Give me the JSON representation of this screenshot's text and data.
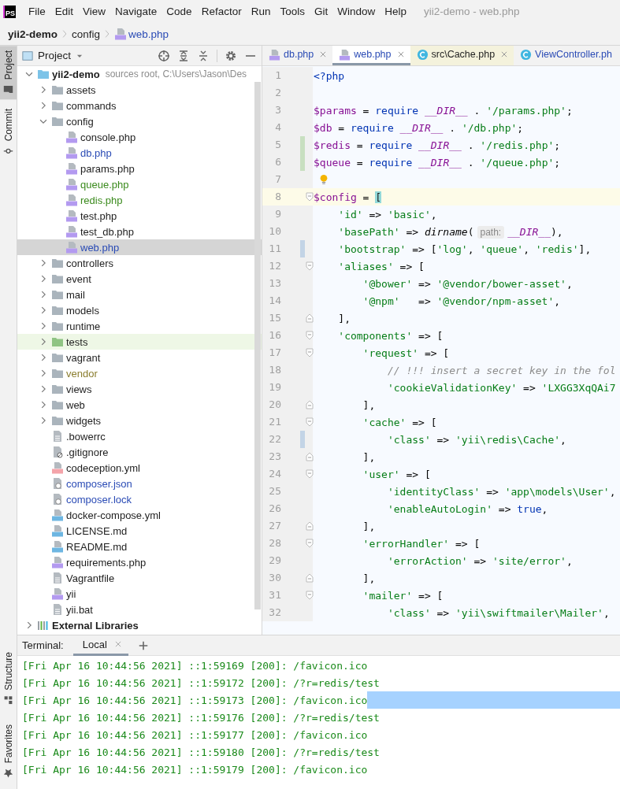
{
  "menu": {
    "logo": "PS",
    "items": [
      "File",
      "Edit",
      "View",
      "Navigate",
      "Code",
      "Refactor",
      "Run",
      "Tools",
      "Git",
      "Window",
      "Help"
    ],
    "title": "yii2-demo - web.php"
  },
  "breadcrumb": [
    {
      "label": "yii2-demo",
      "kind": "project"
    },
    {
      "label": "config",
      "kind": "folder"
    },
    {
      "label": "web.php",
      "kind": "php"
    }
  ],
  "tool_strip": {
    "top": [
      {
        "label": "Project",
        "kind": "project",
        "selected": true
      },
      {
        "label": "Commit",
        "kind": "commit",
        "selected": false
      }
    ],
    "bottom": [
      {
        "label": "Structure",
        "kind": "structure",
        "selected": false
      },
      {
        "label": "Favorites",
        "kind": "favorites",
        "selected": false
      }
    ]
  },
  "project_panel": {
    "title": "Project",
    "items": [
      {
        "name": "yii2-demo",
        "kind": "module",
        "hint": "sources root, C:\\Users\\Jason\\Des",
        "expanded": true,
        "selected": false,
        "children": [
          {
            "name": "assets",
            "kind": "folder",
            "expanded": false,
            "selected": false
          },
          {
            "name": "commands",
            "kind": "folder",
            "expanded": false,
            "selected": false
          },
          {
            "name": "config",
            "kind": "folder",
            "expanded": true,
            "selected": false,
            "children": [
              {
                "name": "console.php",
                "kind": "php",
                "selected": false
              },
              {
                "name": "db.php",
                "kind": "php",
                "color": "#2a4bb5",
                "selected": false
              },
              {
                "name": "params.php",
                "kind": "php",
                "selected": false
              },
              {
                "name": "queue.php",
                "kind": "php",
                "color": "#3a8a1c",
                "selected": false
              },
              {
                "name": "redis.php",
                "kind": "php",
                "color": "#3a8a1c",
                "selected": false
              },
              {
                "name": "test.php",
                "kind": "php",
                "selected": false
              },
              {
                "name": "test_db.php",
                "kind": "php",
                "selected": false
              },
              {
                "name": "web.php",
                "kind": "php",
                "color": "#2a4bb5",
                "selected": true
              }
            ]
          },
          {
            "name": "controllers",
            "kind": "folder",
            "expanded": false,
            "selected": false
          },
          {
            "name": "event",
            "kind": "folder",
            "expanded": false,
            "selected": false
          },
          {
            "name": "mail",
            "kind": "folder",
            "expanded": false,
            "selected": false
          },
          {
            "name": "models",
            "kind": "folder",
            "expanded": false,
            "selected": false
          },
          {
            "name": "runtime",
            "kind": "folder",
            "expanded": false,
            "selected": false
          },
          {
            "name": "tests",
            "kind": "test-folder",
            "expanded": false,
            "selected": false
          },
          {
            "name": "vagrant",
            "kind": "folder",
            "expanded": false,
            "selected": false
          },
          {
            "name": "vendor",
            "kind": "folder",
            "color": "#8a7d2e",
            "expanded": false,
            "selected": false
          },
          {
            "name": "views",
            "kind": "folder",
            "expanded": false,
            "selected": false
          },
          {
            "name": "web",
            "kind": "folder",
            "expanded": false,
            "selected": false
          },
          {
            "name": "widgets",
            "kind": "folder",
            "expanded": false,
            "selected": false
          },
          {
            "name": ".bowerrc",
            "kind": "text",
            "selected": false
          },
          {
            "name": ".gitignore",
            "kind": "ignore",
            "selected": false
          },
          {
            "name": "codeception.yml",
            "kind": "yml",
            "selected": false
          },
          {
            "name": "composer.json",
            "kind": "json",
            "color": "#2a4bb5",
            "selected": false
          },
          {
            "name": "composer.lock",
            "kind": "json",
            "color": "#2a4bb5",
            "selected": false
          },
          {
            "name": "docker-compose.yml",
            "kind": "dc",
            "selected": false
          },
          {
            "name": "LICENSE.md",
            "kind": "md",
            "selected": false
          },
          {
            "name": "README.md",
            "kind": "md",
            "selected": false
          },
          {
            "name": "requirements.php",
            "kind": "php",
            "selected": false
          },
          {
            "name": "Vagrantfile",
            "kind": "text",
            "selected": false
          },
          {
            "name": "yii",
            "kind": "php",
            "selected": false
          },
          {
            "name": "yii.bat",
            "kind": "text",
            "selected": false
          }
        ]
      },
      {
        "name": "External Libraries",
        "kind": "libraries",
        "expanded": false,
        "selected": false
      }
    ]
  },
  "editor": {
    "tabs": [
      {
        "label": "db.php",
        "kind": "php",
        "selected": false,
        "closable": true,
        "non_project": false
      },
      {
        "label": "web.php",
        "kind": "php",
        "selected": true,
        "closable": true,
        "non_project": false
      },
      {
        "label": "src\\Cache.php",
        "kind": "class",
        "selected": false,
        "closable": true,
        "non_project": true
      },
      {
        "label": "ViewController.ph",
        "kind": "class",
        "selected": false,
        "closable": false,
        "non_project": false
      }
    ],
    "lines": [
      {
        "number": "1",
        "current": false,
        "bulb": false,
        "fold_start": false,
        "fold_end": false,
        "tokens": [
          {
            "kind": "keyword",
            "text": "<?php"
          }
        ]
      },
      {
        "number": "2",
        "current": false,
        "bulb": false,
        "fold_start": false,
        "fold_end": false
      },
      {
        "number": "3",
        "current": false,
        "bulb": false,
        "fold_start": false,
        "fold_end": false,
        "tokens": [
          {
            "kind": "variable",
            "text": "$params"
          },
          {
            "kind": "plain",
            "text": " = "
          },
          {
            "kind": "keyword",
            "text": "require "
          },
          {
            "kind": "constant",
            "text": "__DIR__"
          },
          {
            "kind": "plain",
            "text": " . "
          },
          {
            "kind": "string",
            "text": "'/params.php'"
          },
          {
            "kind": "plain",
            "text": ";"
          }
        ]
      },
      {
        "number": "4",
        "current": false,
        "bulb": false,
        "fold_start": false,
        "fold_end": false,
        "tokens": [
          {
            "kind": "variable",
            "text": "$db"
          },
          {
            "kind": "plain",
            "text": " = "
          },
          {
            "kind": "keyword",
            "text": "require "
          },
          {
            "kind": "constant",
            "text": "__DIR__"
          },
          {
            "kind": "plain",
            "text": " . "
          },
          {
            "kind": "string",
            "text": "'/db.php'"
          },
          {
            "kind": "plain",
            "text": ";"
          }
        ]
      },
      {
        "number": "5",
        "color": "#c8dfc0",
        "current": false,
        "bulb": false,
        "fold_start": false,
        "fold_end": false,
        "tokens": [
          {
            "kind": "variable",
            "text": "$redis"
          },
          {
            "kind": "plain",
            "text": " = "
          },
          {
            "kind": "keyword",
            "text": "require "
          },
          {
            "kind": "constant",
            "text": "__DIR__"
          },
          {
            "kind": "plain",
            "text": " . "
          },
          {
            "kind": "string",
            "text": "'/redis.php'"
          },
          {
            "kind": "plain",
            "text": ";"
          }
        ]
      },
      {
        "number": "6",
        "color": "#c8dfc0",
        "current": false,
        "bulb": false,
        "fold_start": false,
        "fold_end": false,
        "tokens": [
          {
            "kind": "variable",
            "text": "$queue"
          },
          {
            "kind": "plain",
            "text": " = "
          },
          {
            "kind": "keyword",
            "text": "require "
          },
          {
            "kind": "constant",
            "text": "__DIR__"
          },
          {
            "kind": "plain",
            "text": " . "
          },
          {
            "kind": "string",
            "text": "'/queue.php'"
          },
          {
            "kind": "plain",
            "text": ";"
          }
        ]
      },
      {
        "number": "7",
        "current": false,
        "bulb": true,
        "fold_start": false,
        "fold_end": false
      },
      {
        "number": "8",
        "current": true,
        "bulb": false,
        "fold_start": true,
        "fold_end": false,
        "tokens": [
          {
            "kind": "variable",
            "text": "$config"
          },
          {
            "kind": "plain",
            "text": " = "
          },
          {
            "kind": "brace-match",
            "text": "["
          }
        ]
      },
      {
        "number": "9",
        "current": false,
        "bulb": false,
        "fold_start": false,
        "fold_end": false,
        "tokens": [
          {
            "kind": "string",
            "text": "    'id'"
          },
          {
            "kind": "plain",
            "text": " => "
          },
          {
            "kind": "string",
            "text": "'basic'"
          },
          {
            "kind": "plain",
            "text": ","
          }
        ]
      },
      {
        "number": "10",
        "current": false,
        "bulb": false,
        "fold_start": false,
        "fold_end": false,
        "tokens": [
          {
            "kind": "string",
            "text": "    'basePath'"
          },
          {
            "kind": "plain",
            "text": " => "
          },
          {
            "kind": "function",
            "text": "dirname"
          },
          {
            "kind": "plain",
            "text": "("
          },
          {
            "kind": "hint",
            "text": "path:"
          },
          {
            "kind": "constant",
            "text": "__DIR__"
          },
          {
            "kind": "plain",
            "text": "),"
          }
        ]
      },
      {
        "number": "11",
        "color": "#c3d4e6",
        "current": false,
        "bulb": false,
        "fold_start": false,
        "fold_end": false,
        "tokens": [
          {
            "kind": "string",
            "text": "    'bootstrap'"
          },
          {
            "kind": "plain",
            "text": " => ["
          },
          {
            "kind": "string",
            "text": "'log'"
          },
          {
            "kind": "plain",
            "text": ", "
          },
          {
            "kind": "string",
            "text": "'queue'"
          },
          {
            "kind": "plain",
            "text": ", "
          },
          {
            "kind": "string",
            "text": "'redis'"
          },
          {
            "kind": "plain",
            "text": "],"
          }
        ]
      },
      {
        "number": "12",
        "current": false,
        "bulb": false,
        "fold_start": true,
        "fold_end": false,
        "tokens": [
          {
            "kind": "string",
            "text": "    'aliases'"
          },
          {
            "kind": "plain",
            "text": " => ["
          }
        ]
      },
      {
        "number": "13",
        "current": false,
        "bulb": false,
        "fold_start": false,
        "fold_end": false,
        "tokens": [
          {
            "kind": "string",
            "text": "        '@bower'"
          },
          {
            "kind": "plain",
            "text": " => "
          },
          {
            "kind": "string",
            "text": "'@vendor/bower-asset'"
          },
          {
            "kind": "plain",
            "text": ","
          }
        ]
      },
      {
        "number": "14",
        "current": false,
        "bulb": false,
        "fold_start": false,
        "fold_end": false,
        "tokens": [
          {
            "kind": "string",
            "text": "        '@npm'"
          },
          {
            "kind": "plain",
            "text": "   => "
          },
          {
            "kind": "string",
            "text": "'@vendor/npm-asset'"
          },
          {
            "kind": "plain",
            "text": ","
          }
        ]
      },
      {
        "number": "15",
        "current": false,
        "bulb": false,
        "fold_start": false,
        "fold_end": true,
        "tokens": [
          {
            "kind": "plain",
            "text": "    ],"
          }
        ]
      },
      {
        "number": "16",
        "current": false,
        "bulb": false,
        "fold_start": true,
        "fold_end": false,
        "tokens": [
          {
            "kind": "string",
            "text": "    'components'"
          },
          {
            "kind": "plain",
            "text": " => ["
          }
        ]
      },
      {
        "number": "17",
        "current": false,
        "bulb": false,
        "fold_start": true,
        "fold_end": false,
        "tokens": [
          {
            "kind": "string",
            "text": "        'request'"
          },
          {
            "kind": "plain",
            "text": " => ["
          }
        ]
      },
      {
        "number": "18",
        "current": false,
        "bulb": false,
        "fold_start": false,
        "fold_end": false,
        "tokens": [
          {
            "kind": "comment",
            "text": "            // !!! insert a secret key in the fol"
          }
        ]
      },
      {
        "number": "19",
        "current": false,
        "bulb": false,
        "fold_start": false,
        "fold_end": false,
        "tokens": [
          {
            "kind": "string",
            "text": "            'cookieValidationKey'"
          },
          {
            "kind": "plain",
            "text": " => "
          },
          {
            "kind": "string",
            "text": "'LXGG3XqQAi7"
          }
        ]
      },
      {
        "number": "20",
        "current": false,
        "bulb": false,
        "fold_start": false,
        "fold_end": true,
        "tokens": [
          {
            "kind": "plain",
            "text": "        ],"
          }
        ]
      },
      {
        "number": "21",
        "current": false,
        "bulb": false,
        "fold_start": true,
        "fold_end": false,
        "tokens": [
          {
            "kind": "string",
            "text": "        'cache'"
          },
          {
            "kind": "plain",
            "text": " => ["
          }
        ]
      },
      {
        "number": "22",
        "color": "#c3d4e6",
        "current": false,
        "bulb": false,
        "fold_start": false,
        "fold_end": false,
        "tokens": [
          {
            "kind": "string",
            "text": "            'class'"
          },
          {
            "kind": "plain",
            "text": " => "
          },
          {
            "kind": "string",
            "text": "'yii\\redis\\Cache'"
          },
          {
            "kind": "plain",
            "text": ","
          }
        ]
      },
      {
        "number": "23",
        "current": false,
        "bulb": false,
        "fold_start": false,
        "fold_end": true,
        "tokens": [
          {
            "kind": "plain",
            "text": "        ],"
          }
        ]
      },
      {
        "number": "24",
        "current": false,
        "bulb": false,
        "fold_start": true,
        "fold_end": false,
        "tokens": [
          {
            "kind": "string",
            "text": "        'user'"
          },
          {
            "kind": "plain",
            "text": " => ["
          }
        ]
      },
      {
        "number": "25",
        "current": false,
        "bulb": false,
        "fold_start": false,
        "fold_end": false,
        "tokens": [
          {
            "kind": "string",
            "text": "            'identityClass'"
          },
          {
            "kind": "plain",
            "text": " => "
          },
          {
            "kind": "string",
            "text": "'app\\models\\User'"
          },
          {
            "kind": "plain",
            "text": ","
          }
        ]
      },
      {
        "number": "26",
        "current": false,
        "bulb": false,
        "fold_start": false,
        "fold_end": false,
        "tokens": [
          {
            "kind": "string",
            "text": "            'enableAutoLogin'"
          },
          {
            "kind": "plain",
            "text": " => "
          },
          {
            "kind": "keyword",
            "text": "true"
          },
          {
            "kind": "plain",
            "text": ","
          }
        ]
      },
      {
        "number": "27",
        "current": false,
        "bulb": false,
        "fold_start": false,
        "fold_end": true,
        "tokens": [
          {
            "kind": "plain",
            "text": "        ],"
          }
        ]
      },
      {
        "number": "28",
        "current": false,
        "bulb": false,
        "fold_start": true,
        "fold_end": false,
        "tokens": [
          {
            "kind": "string",
            "text": "        'errorHandler'"
          },
          {
            "kind": "plain",
            "text": " => ["
          }
        ]
      },
      {
        "number": "29",
        "current": false,
        "bulb": false,
        "fold_start": false,
        "fold_end": false,
        "tokens": [
          {
            "kind": "string",
            "text": "            'errorAction'"
          },
          {
            "kind": "plain",
            "text": " => "
          },
          {
            "kind": "string",
            "text": "'site/error'"
          },
          {
            "kind": "plain",
            "text": ","
          }
        ]
      },
      {
        "number": "30",
        "current": false,
        "bulb": false,
        "fold_start": false,
        "fold_end": true,
        "tokens": [
          {
            "kind": "plain",
            "text": "        ],"
          }
        ]
      },
      {
        "number": "31",
        "current": false,
        "bulb": false,
        "fold_start": true,
        "fold_end": false,
        "tokens": [
          {
            "kind": "string",
            "text": "        'mailer'"
          },
          {
            "kind": "plain",
            "text": " => ["
          }
        ]
      },
      {
        "number": "32",
        "current": false,
        "bulb": false,
        "fold_start": false,
        "fold_end": false,
        "tokens": [
          {
            "kind": "string",
            "text": "            'class'"
          },
          {
            "kind": "plain",
            "text": " => "
          },
          {
            "kind": "string",
            "text": "'yii\\swiftmailer\\Mailer'"
          },
          {
            "kind": "plain",
            "text": ","
          }
        ]
      }
    ]
  },
  "terminal": {
    "label": "Terminal:",
    "tabs": [
      {
        "label": "Local",
        "selected": true,
        "closable": true
      }
    ],
    "lines": [
      {
        "text": "[Fri Apr 16 10:44:56 2021] ::1:59169 [200]: /favicon.ico",
        "highlighted": false
      },
      {
        "text": "[Fri Apr 16 10:44:56 2021] ::1:59172 [200]: /?r=redis/test",
        "highlighted": false
      },
      {
        "text": "[Fri Apr 16 10:44:56 2021] ::1:59173 [200]: /favicon.ico",
        "highlighted": true
      },
      {
        "text": "[Fri Apr 16 10:44:56 2021] ::1:59176 [200]: /?r=redis/test",
        "highlighted": false
      },
      {
        "text": "[Fri Apr 16 10:44:56 2021] ::1:59177 [200]: /favicon.ico",
        "highlighted": false
      },
      {
        "text": "[Fri Apr 16 10:44:56 2021] ::1:59180 [200]: /?r=redis/test",
        "highlighted": false
      },
      {
        "text": "[Fri Apr 16 10:44:56 2021] ::1:59179 [200]: /favicon.ico",
        "highlighted": false
      }
    ]
  }
}
